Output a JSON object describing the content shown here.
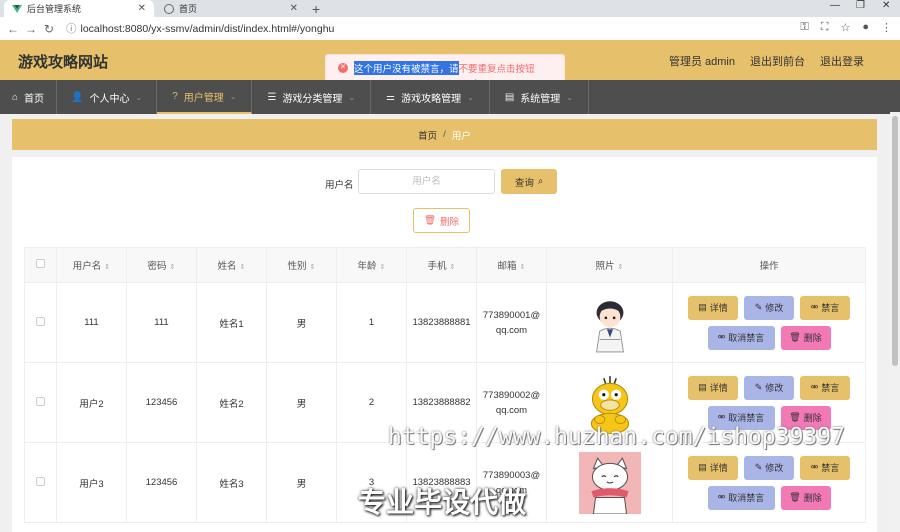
{
  "browser": {
    "tabs": [
      {
        "title": "后台管理系统",
        "active": true
      },
      {
        "title": "首页",
        "active": false
      }
    ],
    "url": "localhost:8080/yx-ssmv/admin/dist/index.html#/yonghu"
  },
  "header": {
    "site_title": "游戏攻略网站",
    "admin_label": "管理员 admin",
    "back_label": "退出到前台",
    "logout_label": "退出登录"
  },
  "toast": {
    "selected_text": "这个用户没有被禁言，请",
    "rest_text": "不要重复点击按钮",
    "color": "#f56c6c"
  },
  "menu": [
    {
      "label": "首页",
      "icon": "home-icon"
    },
    {
      "label": "个人中心",
      "icon": "user-icon",
      "caret": true
    },
    {
      "label": "用户管理",
      "icon": "help-icon",
      "caret": true,
      "active": true
    },
    {
      "label": "游戏分类管理",
      "icon": "list-icon",
      "caret": true
    },
    {
      "label": "游戏攻略管理",
      "icon": "sliders-icon",
      "caret": true
    },
    {
      "label": "系统管理",
      "icon": "box-icon",
      "caret": true
    }
  ],
  "breadcrumb": {
    "home": "首页",
    "sep": "/",
    "current": "用户"
  },
  "search": {
    "label": "用户名",
    "placeholder": "用户名",
    "query_label": "查询",
    "delete_label": "删除"
  },
  "table": {
    "columns": [
      "用户名",
      "密码",
      "姓名",
      "性别",
      "年龄",
      "手机",
      "邮箱",
      "照片",
      "操作"
    ],
    "rows": [
      {
        "username": "111",
        "password": "111",
        "name": "姓名1",
        "gender": "男",
        "age": "1",
        "phone": "13823888881",
        "email_a": "773890001@",
        "email_b": "qq.com"
      },
      {
        "username": "用户2",
        "password": "123456",
        "name": "姓名2",
        "gender": "男",
        "age": "2",
        "phone": "13823888882",
        "email_a": "773890002@",
        "email_b": "qq.com"
      },
      {
        "username": "用户3",
        "password": "123456",
        "name": "姓名3",
        "gender": "男",
        "age": "3",
        "phone": "13823888883",
        "email_a": "773890003@",
        "email_b": "qq.com"
      }
    ],
    "ops": {
      "detail": "详情",
      "edit": "修改",
      "ban": "禁言",
      "unban": "取消禁言",
      "remove": "删除"
    }
  },
  "watermark": {
    "url": "https://www.huzhan.com/ishop39397",
    "slogan": "专业毕设代做"
  },
  "colors": {
    "accent": "#e6c06a",
    "menu_bg": "#4e4e4e",
    "edit": "#a9b5e6",
    "delete": "#f378b6"
  }
}
